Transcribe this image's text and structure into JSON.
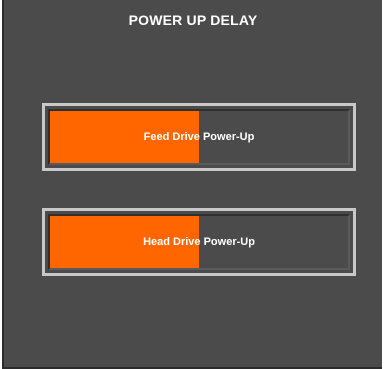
{
  "panel": {
    "title": "POWER UP DELAY"
  },
  "progress_bars": [
    {
      "label": "Feed Drive Power-Up",
      "fill_fraction": 0.5,
      "fill_color": "#ff6600"
    },
    {
      "label": "Head Drive Power-Up",
      "fill_fraction": 0.5,
      "fill_color": "#ff6600"
    }
  ],
  "colors": {
    "panel_background": "#4b4b4b",
    "frame_border": "#c8c8c8",
    "text": "#ffffff"
  }
}
